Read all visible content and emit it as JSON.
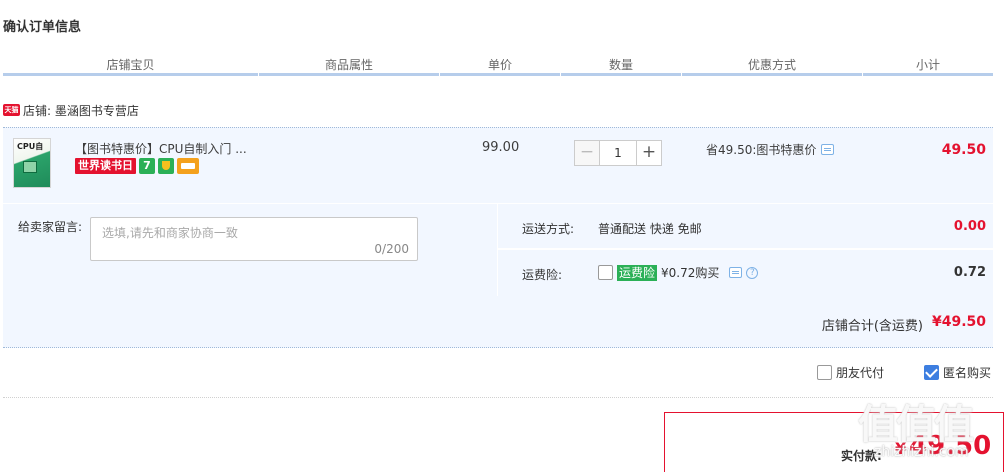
{
  "page": {
    "section_title": "确认订单信息"
  },
  "columns": [
    "店铺宝贝",
    "商品属性",
    "单价",
    "数量",
    "优惠方式",
    "小计"
  ],
  "shop": {
    "badge": "天猫",
    "name": "店铺: 墨涵图书专营店"
  },
  "item": {
    "thumb_text": "CPU自",
    "title": "【图书特惠价】CPU自制入门 ...",
    "tags": [
      "世界读书日",
      "7"
    ],
    "unit_price": "99.00",
    "quantity": "1",
    "minus": "−",
    "plus": "+",
    "discount_text": "省49.50:图书特惠价",
    "subtotal": "49.50"
  },
  "message": {
    "label": "给卖家留言:",
    "placeholder": "选填,请先和商家协商一致",
    "counter": "0/200"
  },
  "shipping": {
    "label": "运送方式:",
    "value": "普通配送 快递 免邮",
    "amount": "0.00"
  },
  "insurance": {
    "label": "运费险:",
    "tag": "运费险",
    "text": "¥0.72购买",
    "help": "?",
    "amount": "0.72"
  },
  "shop_total": {
    "label": "店铺合计(含运费)",
    "amount": "¥49.50"
  },
  "options": {
    "friend_pay": "朋友代付",
    "anonymous": "匿名购买",
    "anonymous_checked": true
  },
  "payment": {
    "label": "实付款:",
    "currency": "¥",
    "amount": "49.50"
  },
  "watermark": {
    "big": "值值值",
    "small": "zhizhizhi.com"
  },
  "colors": {
    "accent_red": "#e4122f",
    "table_bg": "#f2f7ff",
    "header_line": "#b6cdeb",
    "green_tag": "#2bb057",
    "check_blue": "#3d7ee0"
  }
}
